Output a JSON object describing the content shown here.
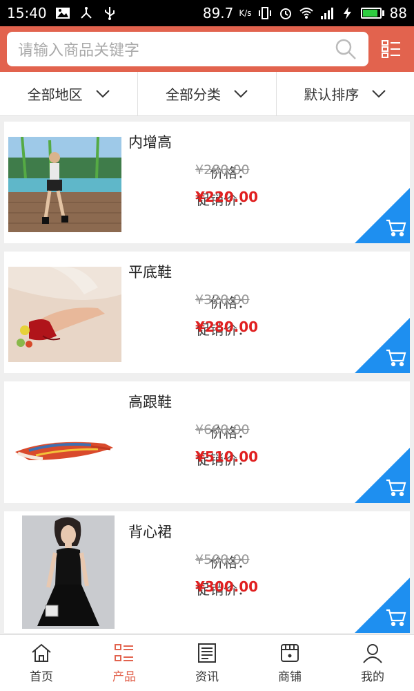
{
  "status": {
    "time": "15:40",
    "speed": "89.7",
    "speed_unit": "K/s",
    "battery": "88",
    "battery_level": 0.88
  },
  "search": {
    "placeholder": "请输入商品关键字"
  },
  "filters": [
    {
      "label": "全部地区"
    },
    {
      "label": "全部分类"
    },
    {
      "label": "默认排序"
    }
  ],
  "price_label": "价格：",
  "sale_label": "促销价：",
  "products": [
    {
      "name": "内增高",
      "price": "¥280.00",
      "sale_price": "¥220.00"
    },
    {
      "name": "平底鞋",
      "price": "¥320.00",
      "sale_price": "¥280.00"
    },
    {
      "name": "高跟鞋",
      "price": "¥660.00",
      "sale_price": "¥510.00"
    },
    {
      "name": "背心裙",
      "price": "¥500.00",
      "sale_price": "¥300.00"
    }
  ],
  "tabs": [
    {
      "label": "首页",
      "icon": "home-icon"
    },
    {
      "label": "产品",
      "icon": "list-icon"
    },
    {
      "label": "资讯",
      "icon": "news-icon"
    },
    {
      "label": "商铺",
      "icon": "store-icon"
    },
    {
      "label": "我的",
      "icon": "user-icon"
    }
  ],
  "colors": {
    "accent": "#e2634e",
    "sale": "#e02020",
    "cart": "#1e8ff0"
  }
}
